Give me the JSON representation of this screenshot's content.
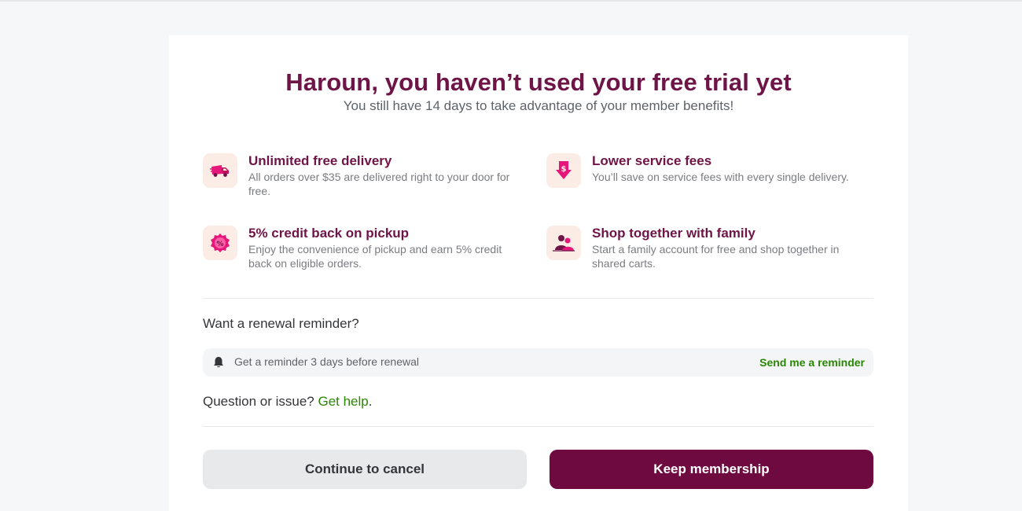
{
  "header": {
    "title": "Haroun, you haven’t used your free trial yet",
    "subtitle": "You still have 14 days to take advantage of your member benefits!"
  },
  "benefits": [
    {
      "icon": "delivery-truck-icon",
      "title": "Unlimited free delivery",
      "description": "All orders over $35 are delivered right to your door for free."
    },
    {
      "icon": "service-fee-down-icon",
      "title": "Lower service fees",
      "description": "You’ll save on service fees with every single delivery."
    },
    {
      "icon": "percent-badge-icon",
      "title": "5% credit back on pickup",
      "description": "Enjoy the convenience of pickup and earn 5% credit back on eligible orders."
    },
    {
      "icon": "family-group-icon",
      "title": "Shop together with family",
      "description": "Start a family account for free and shop together in shared carts."
    }
  ],
  "reminder": {
    "question": "Want a renewal reminder?",
    "text": "Get a reminder 3 days before renewal",
    "button_label": "Send me a reminder",
    "icon": "bell-icon"
  },
  "help": {
    "prefix": "Question or issue? ",
    "link": "Get help",
    "suffix": "."
  },
  "actions": {
    "cancel_label": "Continue to cancel",
    "keep_label": "Keep membership"
  },
  "colors": {
    "brand": "#6e1446",
    "accent_pink": "#e6177a",
    "link_green": "#2a8703",
    "icon_bg": "#fbece6"
  }
}
